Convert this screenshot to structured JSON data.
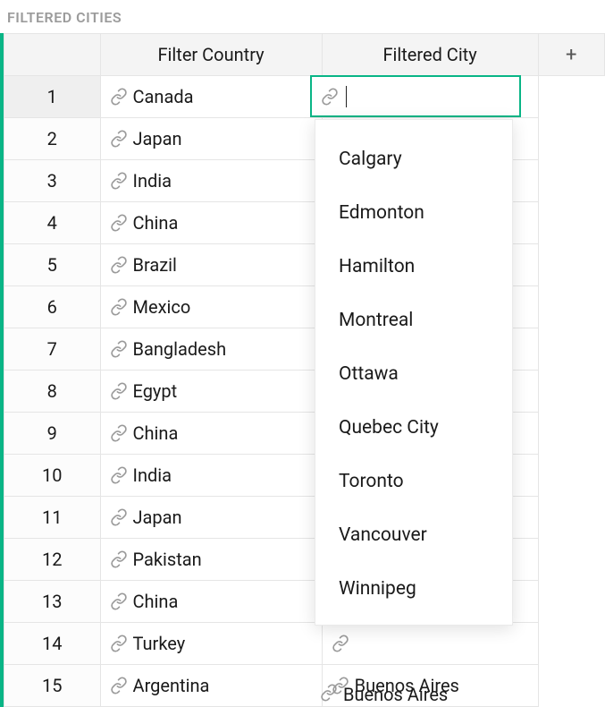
{
  "title": "FILTERED CITIES",
  "columns": {
    "country": "Filter Country",
    "city": "Filtered City",
    "add": "+"
  },
  "link_icon_name": "link-icon",
  "rows": [
    {
      "n": "1",
      "country": "Canada",
      "city": ""
    },
    {
      "n": "2",
      "country": "Japan",
      "city": ""
    },
    {
      "n": "3",
      "country": "India",
      "city": ""
    },
    {
      "n": "4",
      "country": "China",
      "city": ""
    },
    {
      "n": "5",
      "country": "Brazil",
      "city": ""
    },
    {
      "n": "6",
      "country": "Mexico",
      "city": ""
    },
    {
      "n": "7",
      "country": "Bangladesh",
      "city": ""
    },
    {
      "n": "8",
      "country": "Egypt",
      "city": ""
    },
    {
      "n": "9",
      "country": "China",
      "city": ""
    },
    {
      "n": "10",
      "country": "India",
      "city": ""
    },
    {
      "n": "11",
      "country": "Japan",
      "city": ""
    },
    {
      "n": "12",
      "country": "Pakistan",
      "city": ""
    },
    {
      "n": "13",
      "country": "China",
      "city": ""
    },
    {
      "n": "14",
      "country": "Turkey",
      "city": ""
    },
    {
      "n": "15",
      "country": "Argentina",
      "city": "Buenos Aires"
    }
  ],
  "active_cell": {
    "row_index": 0,
    "column": "city",
    "value": ""
  },
  "dropdown": {
    "options": [
      "Calgary",
      "Edmonton",
      "Hamilton",
      "Montreal",
      "Ottawa",
      "Quebec City",
      "Toronto",
      "Vancouver",
      "Winnipeg"
    ]
  },
  "accent_color": "#09b586"
}
